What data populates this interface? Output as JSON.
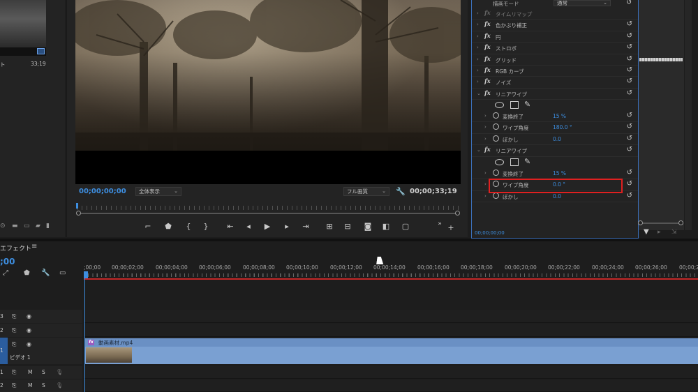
{
  "project": {
    "item_name": "ト",
    "item_duration": "33;19"
  },
  "monitor": {
    "timecode_current": "00;00;00;00",
    "zoom_select": "全体表示",
    "resolution_select": "フル画質",
    "timecode_duration": "00;00;33;19"
  },
  "effect_controls": {
    "blend_mode_label": "描画モード",
    "blend_mode_value": "通常",
    "effects": [
      {
        "label": "タイムリマップ",
        "enabled": false
      },
      {
        "label": "色かぶり補正",
        "enabled": true
      },
      {
        "label": "円",
        "enabled": true
      },
      {
        "label": "ストロボ",
        "enabled": true
      },
      {
        "label": "グリッド",
        "enabled": true
      },
      {
        "label": "RGB カーブ",
        "enabled": true
      },
      {
        "label": "ノイズ",
        "enabled": true
      },
      {
        "label": "リニアワイプ",
        "enabled": true
      }
    ],
    "wipe1": {
      "props": [
        {
          "label": "変換終了",
          "value": "15 %"
        },
        {
          "label": "ワイプ角度",
          "value": "180.0 °"
        },
        {
          "label": "ぼかし",
          "value": "0.0"
        }
      ]
    },
    "wipe2_label": "リニアワイプ",
    "wipe2": {
      "props": [
        {
          "label": "変換終了",
          "value": "15 %"
        },
        {
          "label": "ワイプ角度",
          "value": "0.0 °"
        },
        {
          "label": "ぼかし",
          "value": "0.0"
        }
      ]
    },
    "timecode": "00;00;00;00"
  },
  "timeline": {
    "panel_title": "エフェクト",
    "menu_icon": "≡",
    "timecode": ";00",
    "ruler": [
      ";00;00",
      "00;00;02;00",
      "00;00;04;00",
      "00;00;06;00",
      "00;00;08;00",
      "00;00;10;00",
      "00;00;12;00",
      "00;00;14;00",
      "00;00;16;00",
      "00;00;18;00",
      "00;00;20;00",
      "00;00;22;00",
      "00;00;24;00",
      "00;00;26;00",
      "00;00;2"
    ],
    "tracks": {
      "v3": "3",
      "v2": "2",
      "v1": "1",
      "v1_name": "ビデオ 1",
      "a1": "1",
      "a2": "2",
      "mute": "M",
      "solo": "S"
    },
    "clip_name": "動画素材.mp4",
    "clip_fx_badge": "fx"
  }
}
